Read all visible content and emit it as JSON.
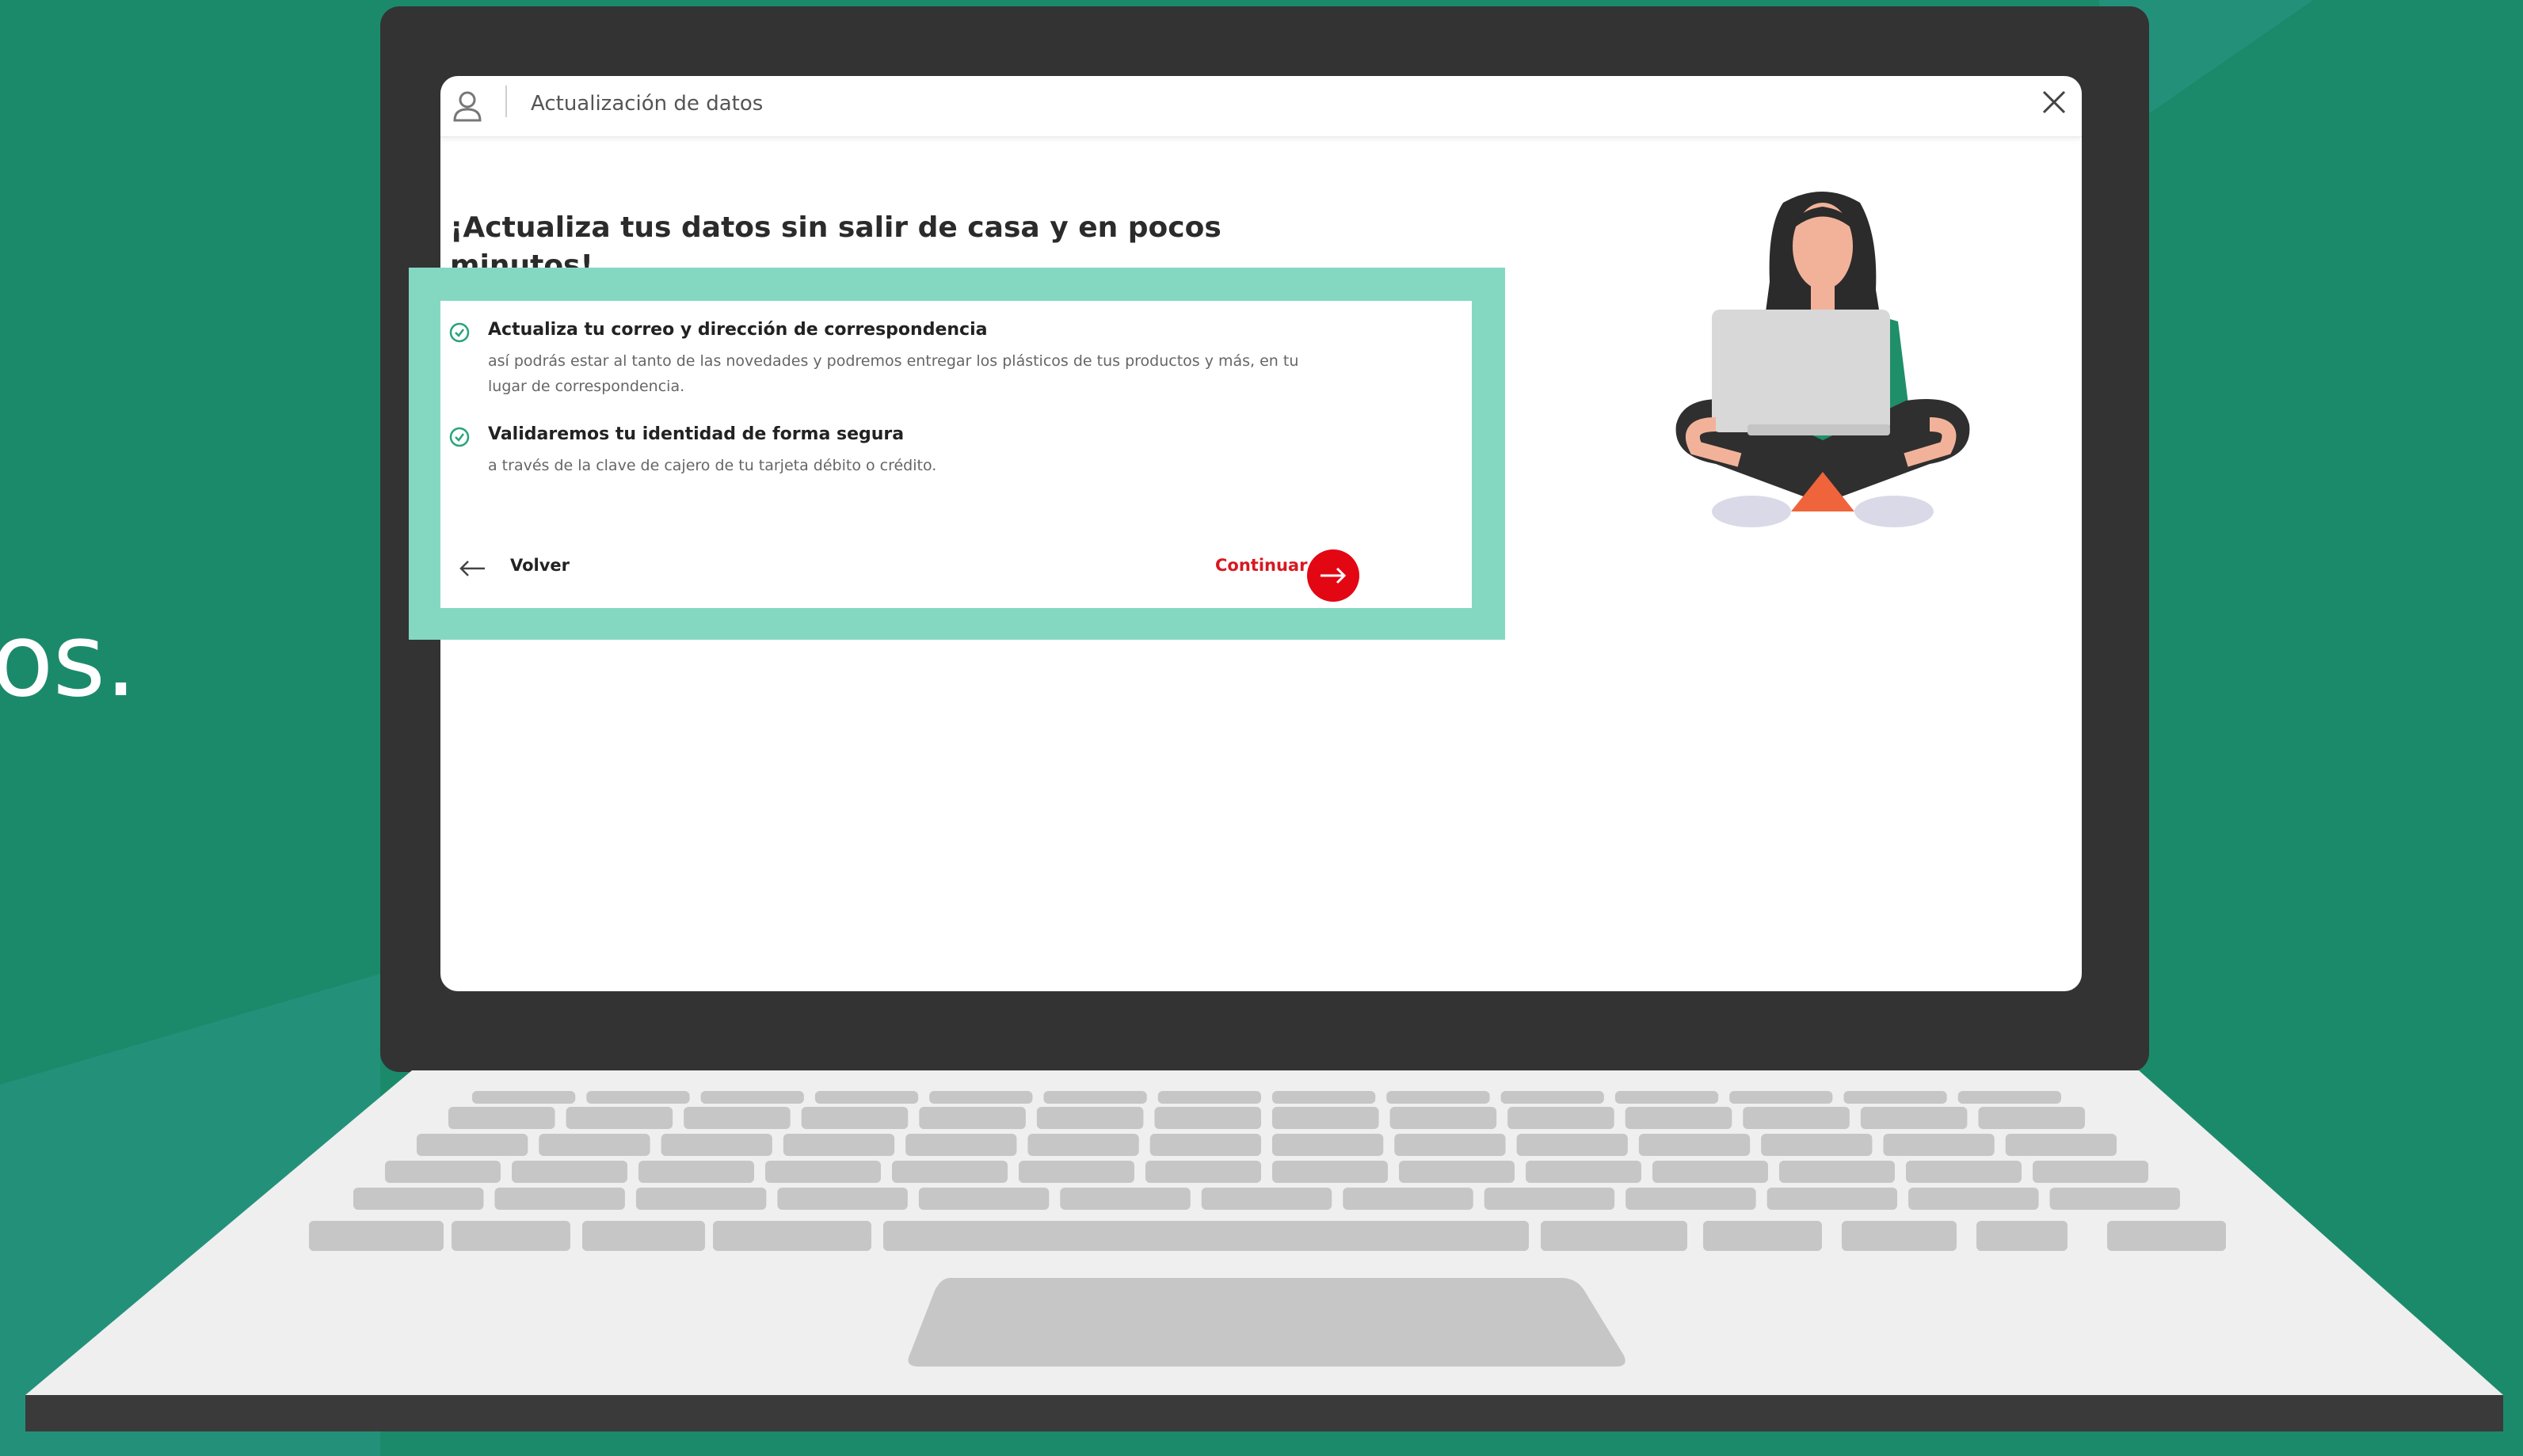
{
  "background": {
    "color": "#1b8a6b",
    "side_text": "tos."
  },
  "window": {
    "title": "Actualización de datos",
    "user_icon": "user-icon",
    "close_icon": "close-icon"
  },
  "content": {
    "headline": "¡Actualiza tus datos sin salir de casa y en pocos minutos!",
    "features": [
      {
        "icon": "check-circle-icon",
        "title": "Actualiza tu correo y dirección de correspondencia",
        "description": "así podrás estar al tanto de las novedades y podremos entregar los plásticos de tus productos y más, en tu lugar de correspondencia."
      },
      {
        "icon": "check-circle-icon",
        "title": "Validaremos tu identidad de forma segura",
        "description": "a través de la clave de cajero de tu tarjeta débito o crédito."
      }
    ],
    "back_label": "Volver",
    "continue_label": "Continuar",
    "accent_color": "#e30613",
    "highlight_color": "#84d8c2"
  }
}
